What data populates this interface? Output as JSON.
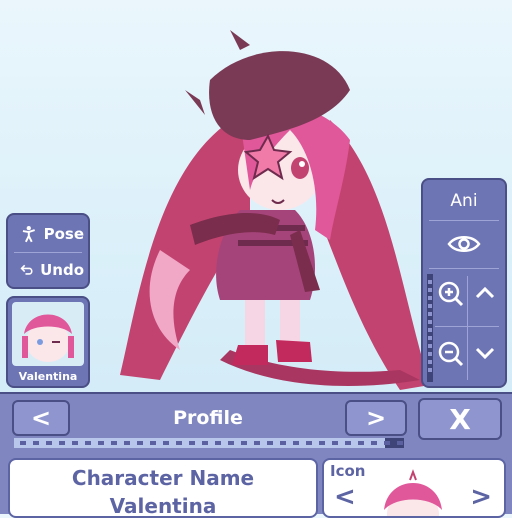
{
  "side_menu": {
    "pose_label": "Pose",
    "undo_label": "Undo",
    "pose_icon": "pose-figure-icon",
    "undo_icon": "undo-arrow-icon"
  },
  "character_card": {
    "name": "Valentina"
  },
  "right_panel": {
    "ani_label": "Ani",
    "eye_icon": "eye-icon",
    "zoom_in_icon": "zoom-in-icon",
    "zoom_out_icon": "zoom-out-icon",
    "up_icon": "chevron-up-icon",
    "down_icon": "chevron-down-icon"
  },
  "bottom_panel": {
    "prev_label": "<",
    "title": "Profile",
    "next_label": ">",
    "close_label": "X",
    "progress": 0.95,
    "character_name_label": "Character Name",
    "character_name_value": "Valentina",
    "icon_label": "Icon",
    "icon_prev_label": "<",
    "icon_next_label": ">"
  },
  "colors": {
    "panel": "#6e75b4",
    "panel_border": "#4a4f86",
    "background": "#d9eff9",
    "text_accent": "#5d64a4",
    "hair": "#e0579a",
    "hat": "#7a3a55"
  }
}
